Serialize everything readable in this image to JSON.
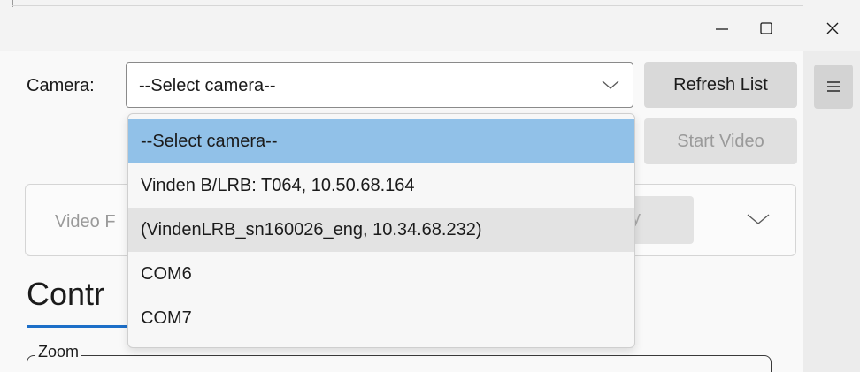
{
  "window": {
    "minimize_icon": "minimize-icon",
    "maximize_icon": "maximize-icon",
    "close_icon": "close-icon"
  },
  "menu": {
    "icon": "hamburger-icon"
  },
  "camera": {
    "label": "Camera:",
    "selected": "--Select camera--",
    "options": [
      "--Select camera--",
      "Vinden B/LRB: T064, 10.50.68.164",
      "(VindenLRB_sn160026_eng, 10.34.68.232)",
      "COM6",
      "COM7"
    ],
    "highlighted_index": 0,
    "hovered_index": 2
  },
  "buttons": {
    "refresh": "Refresh List",
    "start_video": "Start Video",
    "apply_partial": "y"
  },
  "video_panel": {
    "label_partial": "Video F"
  },
  "controls": {
    "heading_partial": "Contr"
  },
  "zoom": {
    "legend": "Zoom"
  },
  "colors": {
    "selected_option": "#91c1e8",
    "hover_option": "#e3e3e3",
    "accent_underline": "#1d6fc8"
  }
}
